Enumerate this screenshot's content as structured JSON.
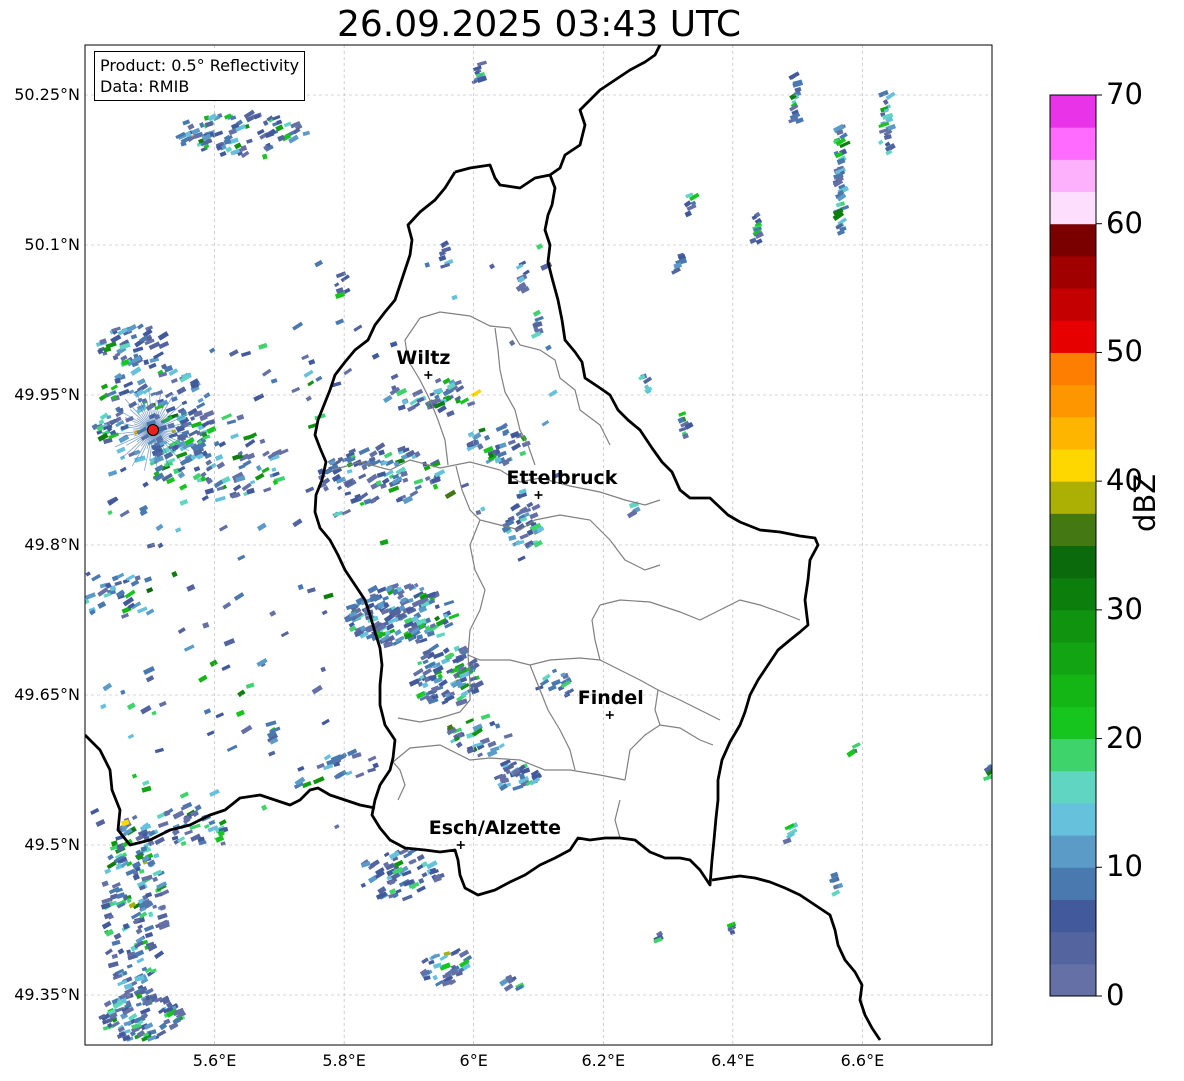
{
  "title": "26.09.2025 03:43 UTC",
  "info": {
    "product": "Product: 0.5° Reflectivity",
    "source": "Data: RMIB"
  },
  "map": {
    "extent": {
      "lon_min": 5.4,
      "lon_max": 6.8,
      "lat_min": 49.3,
      "lat_max": 50.3
    },
    "lat_ticks": [
      {
        "value": 50.25,
        "label": "50.25°N"
      },
      {
        "value": 50.1,
        "label": "50.1°N"
      },
      {
        "value": 49.95,
        "label": "49.95°N"
      },
      {
        "value": 49.8,
        "label": "49.8°N"
      },
      {
        "value": 49.65,
        "label": "49.65°N"
      },
      {
        "value": 49.5,
        "label": "49.5°N"
      },
      {
        "value": 49.35,
        "label": "49.35°N"
      }
    ],
    "lon_ticks": [
      {
        "value": 5.6,
        "label": "5.6°E"
      },
      {
        "value": 5.8,
        "label": "5.8°E"
      },
      {
        "value": 6.0,
        "label": "6°E"
      },
      {
        "value": 6.2,
        "label": "6.2°E"
      },
      {
        "value": 6.4,
        "label": "6.4°E"
      },
      {
        "value": 6.6,
        "label": "6.6°E"
      }
    ],
    "cities": [
      {
        "name": "Wiltz",
        "lon": 5.93,
        "lat": 49.97
      },
      {
        "name": "Ettelbruck",
        "lon": 6.1,
        "lat": 49.85
      },
      {
        "name": "Findel",
        "lon": 6.21,
        "lat": 49.63
      },
      {
        "name": "Esch/Alzette",
        "lon": 5.98,
        "lat": 49.5
      }
    ],
    "radar_site": {
      "lon": 5.505,
      "lat": 49.915,
      "color": "#e8201e"
    }
  },
  "colorbar": {
    "label": "dBZ",
    "min": 0,
    "max": 70,
    "ticks": [
      "0",
      "10",
      "20",
      "30",
      "40",
      "50",
      "60",
      "70"
    ],
    "colors": [
      "#6470a6",
      "#53649e",
      "#42599c",
      "#4a79b0",
      "#5a9bc8",
      "#66c1dc",
      "#60d6c2",
      "#3fd36c",
      "#16c61e",
      "#13b615",
      "#12a412",
      "#109410",
      "#0c7e0c",
      "#0b6a0b",
      "#447812",
      "#acb005",
      "#fed600",
      "#fdb500",
      "#fe9600",
      "#fd7e00",
      "#e60000",
      "#c40000",
      "#a00000",
      "#7a0000",
      "#fddffd",
      "#fdb1fd",
      "#fe6bfe",
      "#e933e9"
    ]
  }
}
